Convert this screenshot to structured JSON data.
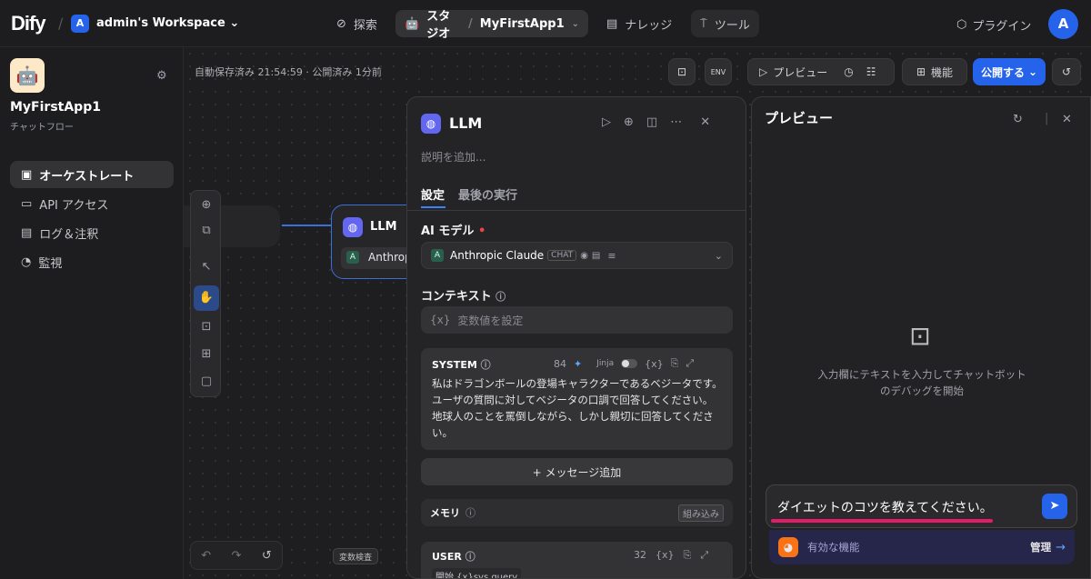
{
  "topbar": {
    "logo": "Dify",
    "workspace_initial": "A",
    "workspace_name": "admin's Workspace",
    "nav_explore": "探索",
    "nav_studio": "スタジオ",
    "nav_app": "MyFirstApp1",
    "nav_knowledge": "ナレッジ",
    "nav_tools": "ツール",
    "plugins": "プラグイン",
    "avatar": "A"
  },
  "sidebar": {
    "app_icon": "🤖",
    "app_name": "MyFirstApp1",
    "app_type": "チャットフロー",
    "items": [
      {
        "label": "オーケストレート"
      },
      {
        "label": "API アクセス"
      },
      {
        "label": "ログ＆注釈"
      },
      {
        "label": "監視"
      }
    ]
  },
  "toolbar": {
    "save_status": "自動保存済み 21:54:59 · 公開済み 1分前",
    "env": "ENV",
    "preview": "プレビュー",
    "features": "機能",
    "publish": "公開する"
  },
  "node": {
    "title": "LLM",
    "model": "Anthropic"
  },
  "panel": {
    "title": "LLM",
    "description_placeholder": "説明を追加...",
    "tab_settings": "設定",
    "tab_last_run": "最後の実行",
    "model_label": "AI モデル",
    "model_name": "Anthropic Claude",
    "model_badge": "CHAT",
    "context_label": "コンテキスト",
    "context_placeholder": "変数値を設定",
    "system_label": "SYSTEM",
    "system_count": "84",
    "jinja": "Jinja",
    "system_text": "私はドラゴンボールの登場キャラクターであるベジータです。ユーザの質問に対してベジータの口調で回答してください。地球人のことを罵倒しながら、しかし親切に回答してください。",
    "add_message": "+ メッセージ追加",
    "memory_label": "メモリ",
    "builtin": "組み込み",
    "user_label": "USER",
    "user_count": "32",
    "user_var": "開始 {x}sys.query"
  },
  "preview": {
    "title": "プレビュー",
    "empty_text": "入力欄にテキストを入力してチャットボットのデバッグを開始",
    "input_value": "ダイエットのコツを教えてください。",
    "features_label": "有効な機能",
    "manage": "管理"
  },
  "canvas": {
    "var_inspect": "変数検査"
  },
  "colors": {
    "accent": "#2563eb",
    "underline": "#e11d6a"
  }
}
